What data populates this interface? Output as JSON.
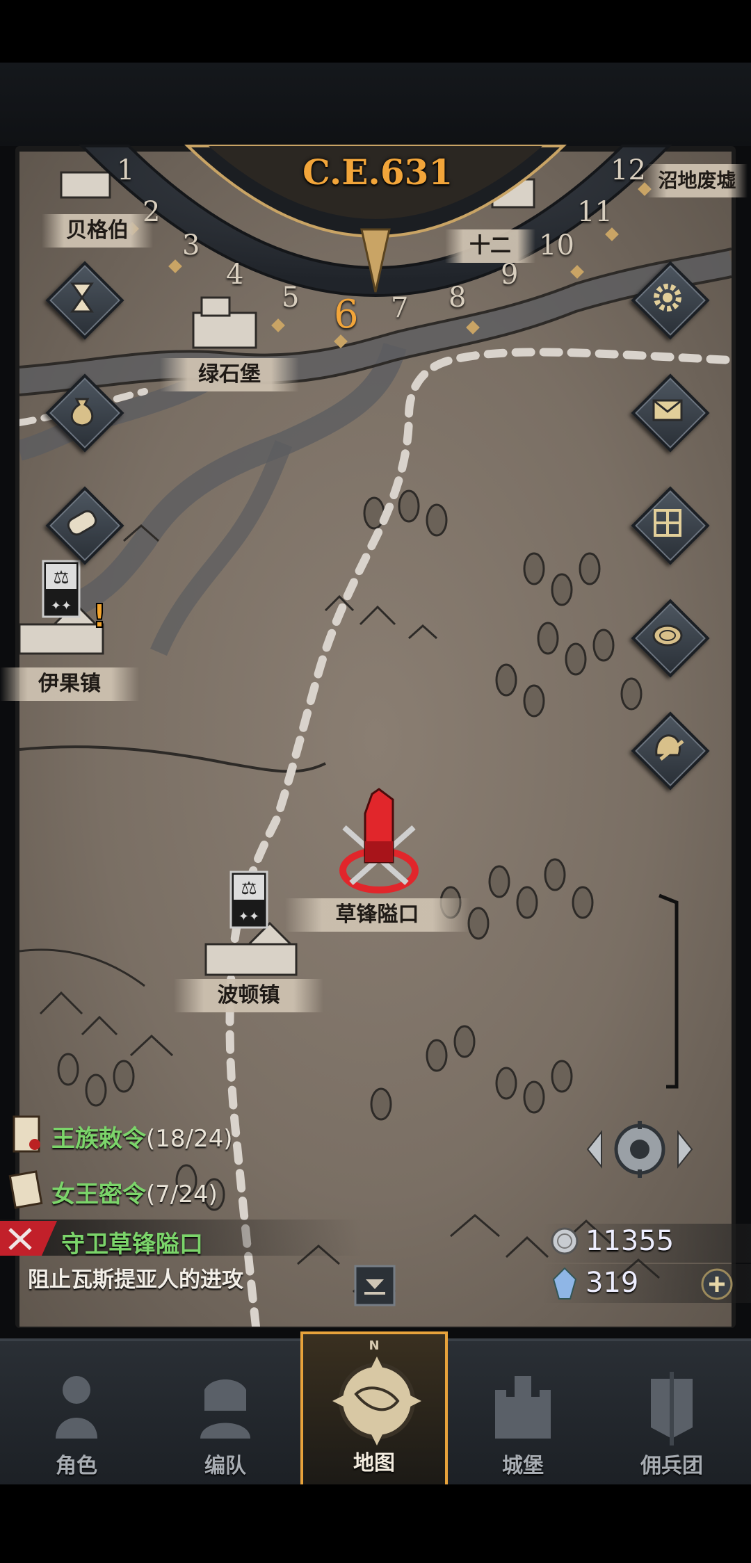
{
  "calendar": {
    "era": "C.E.631",
    "months": [
      "1",
      "2",
      "3",
      "4",
      "5",
      "6",
      "7",
      "8",
      "9",
      "10",
      "11",
      "12"
    ],
    "current_month": "6"
  },
  "map": {
    "locations": [
      {
        "name": "贝格伯",
        "status": ""
      },
      {
        "name": "绿石堡",
        "status": ""
      },
      {
        "name": "十二",
        "status": ""
      },
      {
        "name": "沼地废墟",
        "status": ""
      },
      {
        "name": "伊果镇",
        "status": "alert"
      },
      {
        "name": "波顿镇",
        "status": ""
      },
      {
        "name": "草锋隘口",
        "status": "active-battle"
      }
    ]
  },
  "left_buttons": [
    "hourglass-icon",
    "money-bag-icon",
    "scroll-icon"
  ],
  "right_buttons": [
    "gear-icon",
    "mail-icon",
    "grid-icon",
    "coin-icon",
    "helmet-icon"
  ],
  "quests": [
    {
      "title": "王族敕令",
      "count": "(18/24)"
    },
    {
      "title": "女王密令",
      "count": "(7/24)"
    }
  ],
  "active_quest": {
    "title": "守卫草锋隘口",
    "desc": "阻止瓦斯提亚人的进攻"
  },
  "resources": {
    "silver": "11355",
    "crystal": "319"
  },
  "nav": [
    {
      "label": "角色",
      "active": false
    },
    {
      "label": "编队",
      "active": false
    },
    {
      "label": "地图",
      "active": true
    },
    {
      "label": "城堡",
      "active": false
    },
    {
      "label": "佣兵团",
      "active": false
    }
  ],
  "compass_letter": "N",
  "colors": {
    "accent": "#f2a53a",
    "quest_green": "#7bd46a",
    "map_bg": "#7a6f64"
  }
}
